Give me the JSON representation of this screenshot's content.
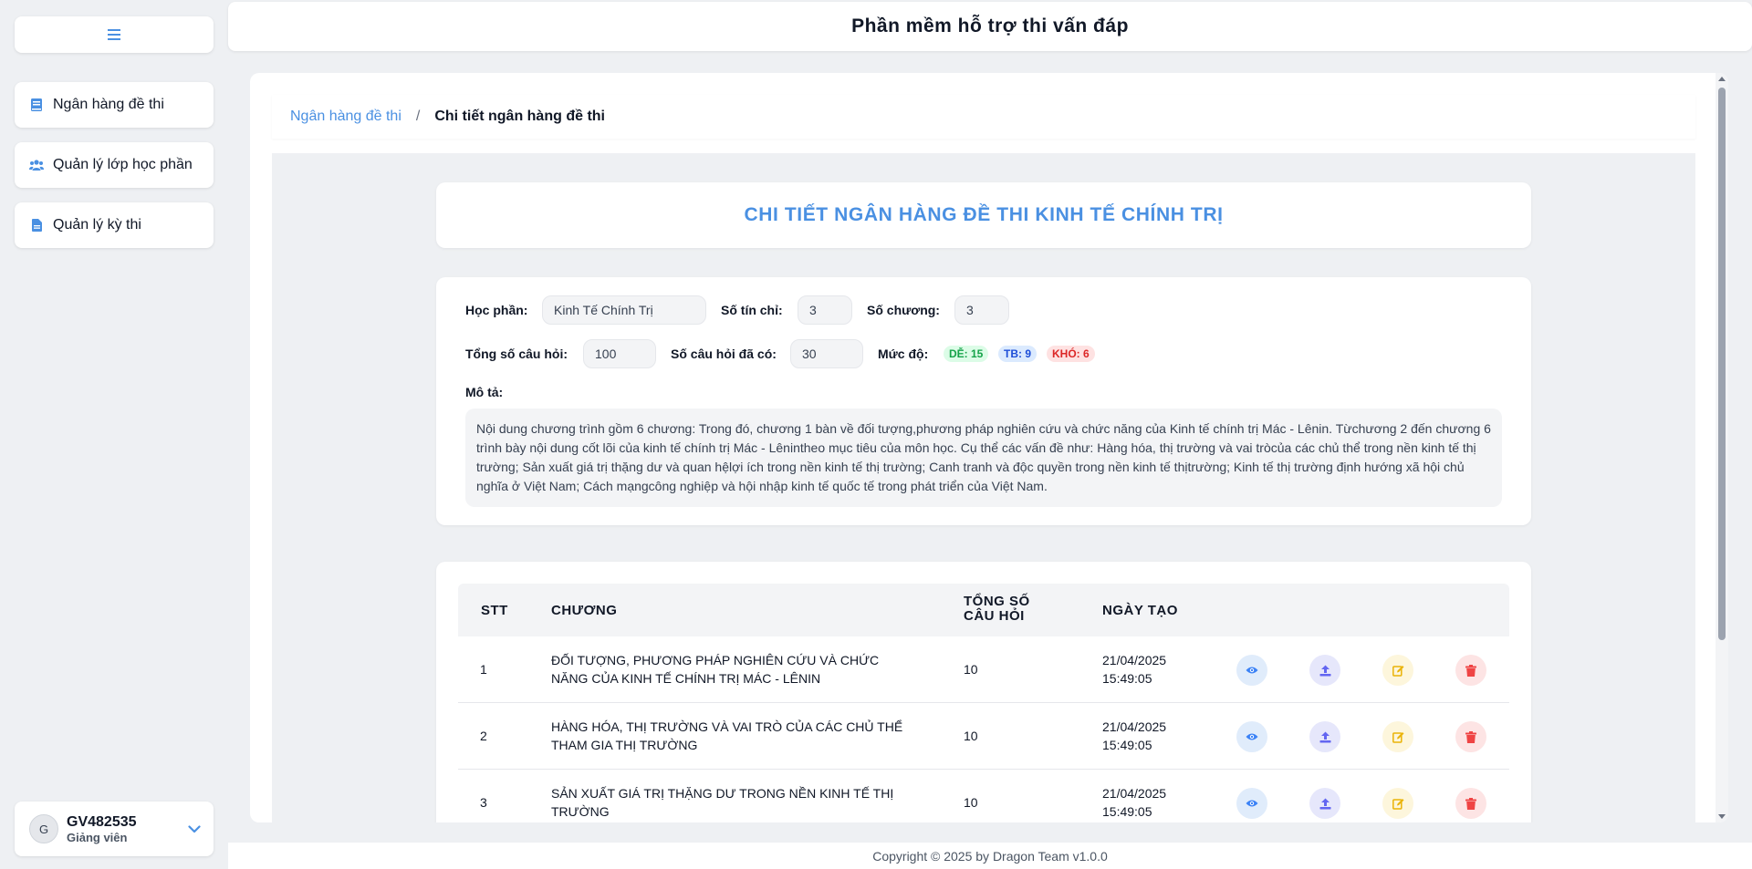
{
  "app": {
    "title": "Phần mềm hỗ trợ thi vấn đáp"
  },
  "sidebar": {
    "items": [
      {
        "label": "Ngân hàng đề thi",
        "icon": "book-icon"
      },
      {
        "label": "Quản lý lớp học phần",
        "icon": "users-icon"
      },
      {
        "label": "Quản lý kỳ thi",
        "icon": "file-icon"
      }
    ]
  },
  "user": {
    "avatar_letter": "G",
    "name": "GV482535",
    "role": "Giảng viên"
  },
  "breadcrumb": {
    "parent": "Ngân hàng đề thi",
    "separator": "/",
    "current": "Chi tiết ngân hàng đề thi"
  },
  "page": {
    "title": "CHI TIẾT NGÂN HÀNG ĐỀ THI KINH TẾ CHÍNH TRỊ"
  },
  "info": {
    "course_label": "Học phần:",
    "course_value": "Kinh Tế Chính Trị",
    "credits_label": "Số tín chỉ:",
    "credits_value": "3",
    "chapters_label": "Số chương:",
    "chapters_value": "3",
    "total_label": "Tổng số câu hỏi:",
    "total_value": "100",
    "have_label": "Số câu hỏi đã có:",
    "have_value": "30",
    "level_label": "Mức độ:",
    "levels": [
      {
        "label": "DỄ: 15",
        "color": "#16a34a",
        "bg": "#dcfce7"
      },
      {
        "label": "TB: 9",
        "color": "#1d4ed8",
        "bg": "#dbeafe"
      },
      {
        "label": "KHÓ: 6",
        "color": "#dc2626",
        "bg": "#fee2e2"
      }
    ],
    "desc_label": "Mô tả:",
    "description": "Nội dung chương trình gồm 6 chương: Trong đó, chương 1 bàn về đối tượng,phương pháp nghiên cứu và chức năng của Kinh tế chính trị Mác - Lênin. Từchương 2 đến chương 6 trình bày nội dung cốt lõi của kinh tế chính trị Mác - Lênintheo mục tiêu của môn học. Cụ thể các vấn đề như: Hàng hóa, thị trường và vai tròcủa các chủ thể trong nền kinh tế thị trường; Sản xuất giá trị thặng dư và quan hệlợi ích trong nền kinh tế thị trường; Canh tranh và độc quyền trong nền kinh tế thịtrường; Kinh tế thị trường định hướng xã hội chủ nghĩa ở Việt Nam; Cách mạngcông nghiệp và hội nhập kinh tế quốc tế trong phát triển của Việt Nam."
  },
  "table": {
    "headers": {
      "stt": "STT",
      "chapter": "CHƯƠNG",
      "total_1": "TỔNG SỐ",
      "total_2": "CÂU HỎI",
      "date": "NGÀY TẠO"
    },
    "rows": [
      {
        "stt": "1",
        "chapter": "ĐỐI TƯỢNG, PHƯƠNG PHÁP NGHIÊN CỨU VÀ CHỨC NĂNG CỦA KINH TẾ CHÍNH TRỊ MÁC - LÊNIN",
        "total": "10",
        "date": "21/04/2025",
        "time": "15:49:05"
      },
      {
        "stt": "2",
        "chapter": "HÀNG HÓA, THỊ TRƯỜNG VÀ VAI TRÒ CỦA CÁC CHỦ THỂ THAM GIA THỊ TRƯỜNG",
        "total": "10",
        "date": "21/04/2025",
        "time": "15:49:05"
      },
      {
        "stt": "3",
        "chapter": "SẢN XUẤT GIÁ TRỊ THẶNG DƯ TRONG NỀN KINH TẾ THỊ TRƯỜNG",
        "total": "10",
        "date": "21/04/2025",
        "time": "15:49:05"
      }
    ],
    "action_icons": [
      "eye-icon",
      "upload-icon",
      "edit-icon",
      "trash-icon"
    ]
  },
  "footer": {
    "text": "Copyright © 2025 by Dragon Team v1.0.0"
  },
  "colors": {
    "accent": "#4a90e2",
    "view": "#3b82f6",
    "upload": "#6366f1",
    "edit": "#eab308",
    "delete": "#ef4444"
  }
}
